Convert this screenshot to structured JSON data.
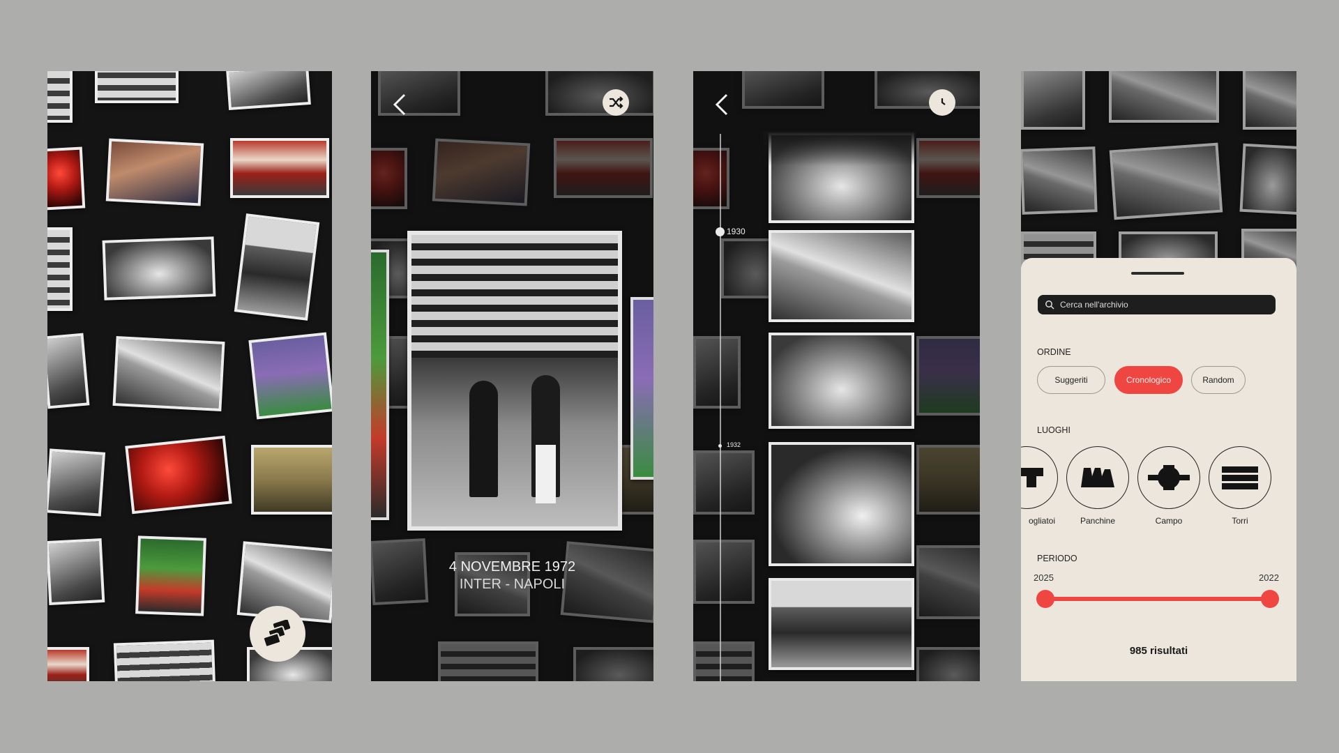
{
  "screen1": {
    "stack_button_icon": "stack-icon"
  },
  "screen2": {
    "back_icon": "chevron-left-icon",
    "shuffle_icon": "shuffle-icon",
    "photo_date": "4 NOVEMBRE 1972",
    "photo_match": "INTER - NAPOLI"
  },
  "screen3": {
    "back_icon": "chevron-left-icon",
    "clock_icon": "clock-icon",
    "timeline_labels": [
      "1930",
      "1932"
    ]
  },
  "screen4": {
    "search": {
      "placeholder": "Cerca nell'archivio"
    },
    "ordine": {
      "label": "ORDINE",
      "options": [
        "Suggeriti",
        "Cronologico",
        "Random"
      ],
      "selected": "Cronologico"
    },
    "luoghi": {
      "label": "LUOGHI",
      "places": [
        "ogliatoi",
        "Panchine",
        "Campo",
        "Torri"
      ]
    },
    "periodo": {
      "label": "PERIODO",
      "from": "2025",
      "to": "2022"
    },
    "results": "985 risultati"
  },
  "colors": {
    "background": "#adadab",
    "screen": "#141414",
    "sheet": "#ece6dc",
    "accent": "#ef4642"
  }
}
